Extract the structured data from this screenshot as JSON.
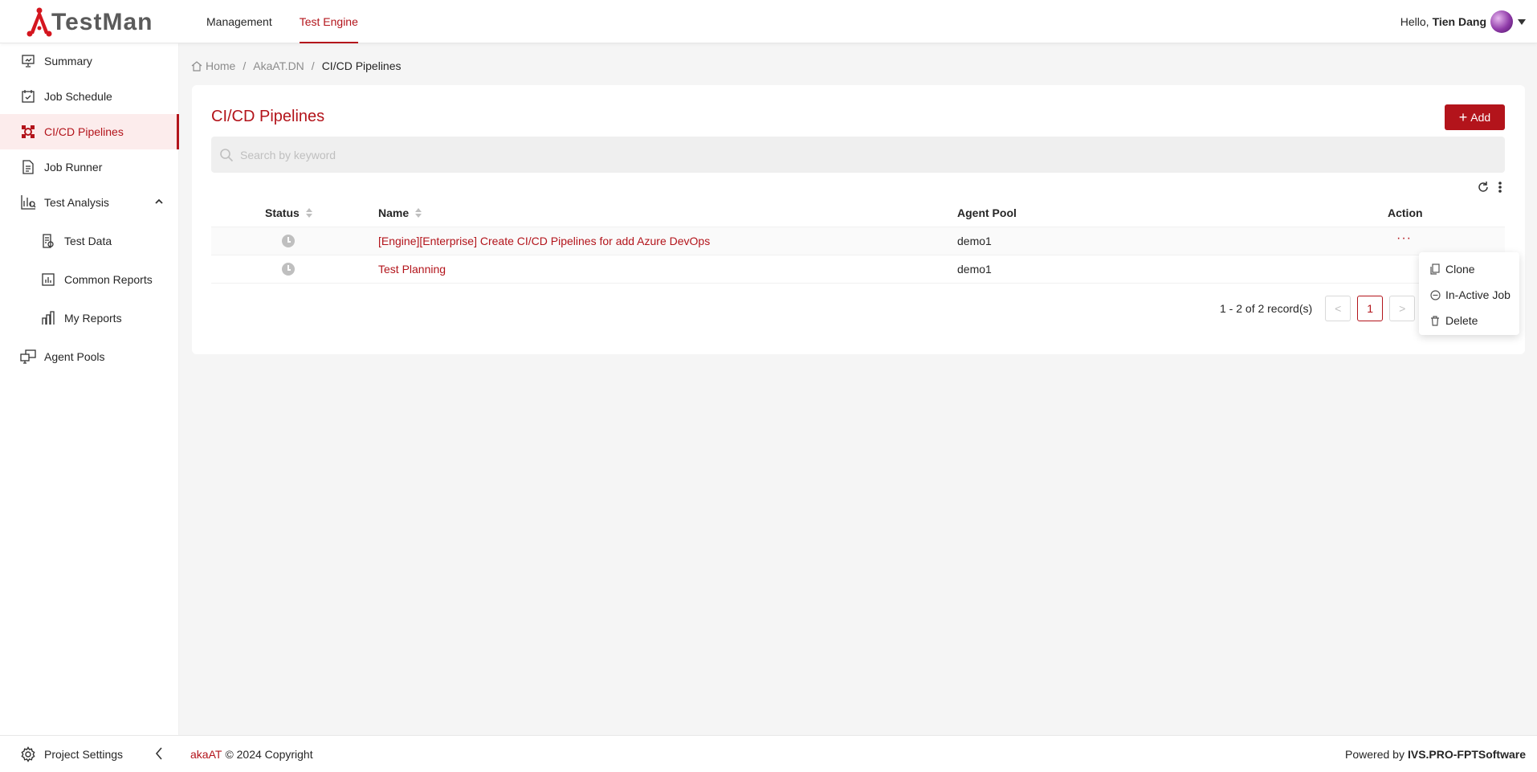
{
  "app": {
    "logo_text": "TestMan",
    "accent_color": "#b3141b"
  },
  "topnav": {
    "items": [
      "Management",
      "Test Engine"
    ],
    "active": "Test Engine"
  },
  "user": {
    "greeting": "Hello,",
    "name": "Tien Dang"
  },
  "sidebar": {
    "items": [
      {
        "label": "Summary",
        "icon": "presentation-icon"
      },
      {
        "label": "Job Schedule",
        "icon": "calendar-check-icon"
      },
      {
        "label": "CI/CD Pipelines",
        "icon": "pipeline-icon",
        "active": true
      },
      {
        "label": "Job Runner",
        "icon": "document-icon"
      },
      {
        "label": "Test Analysis",
        "icon": "analytics-icon",
        "expanded": true
      },
      {
        "label": "Test Data",
        "icon": "data-sheet-icon"
      },
      {
        "label": "Common Reports",
        "icon": "report-chart-icon"
      },
      {
        "label": "My Reports",
        "icon": "bar-chart-icon"
      },
      {
        "label": "Agent Pools",
        "icon": "agents-icon"
      }
    ]
  },
  "breadcrumb": {
    "home": "Home",
    "project": "AkaAT.DN",
    "current": "CI/CD Pipelines"
  },
  "page": {
    "title": "CI/CD Pipelines",
    "add_label": "Add",
    "search_placeholder": "Search by keyword"
  },
  "table": {
    "columns": {
      "status": "Status",
      "name": "Name",
      "agent_pool": "Agent Pool",
      "action": "Action"
    },
    "rows": [
      {
        "status": "pending",
        "name": "[Engine][Enterprise] Create CI/CD Pipelines for add Azure DevOps",
        "agent_pool": "demo1",
        "action": "···"
      },
      {
        "status": "pending",
        "name": "Test Planning",
        "agent_pool": "demo1",
        "action": "···"
      }
    ]
  },
  "pagination": {
    "info": "1 - 2 of 2 record(s)",
    "current_page": "1",
    "prev": "<",
    "next": ">"
  },
  "action_menu": {
    "items": [
      "Clone",
      "In-Active Job",
      "Delete"
    ]
  },
  "footer": {
    "project_settings": "Project Settings",
    "brand": "akaAT",
    "copyright": "© 2024 Copyright",
    "powered_by": "Powered by",
    "powered_company": "IVS.PRO-FPTSoftware"
  }
}
